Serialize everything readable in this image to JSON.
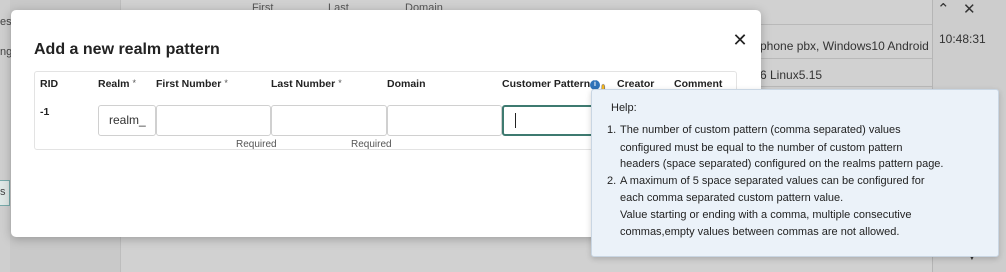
{
  "background": {
    "left_fragments": [
      "es",
      "ng",
      "s"
    ],
    "column_headers": [
      "First",
      "Last",
      "Domain"
    ],
    "row1_text": "phone pbx, Windows10 Android",
    "row2_text": "6 Linux5.15",
    "time": "10:48:31"
  },
  "modal": {
    "title": "Add a new realm pattern",
    "headers": {
      "rid": "RID",
      "realm": "Realm",
      "first_number": "First Number",
      "last_number": "Last Number",
      "domain": "Domain",
      "customer_pattern": "Customer Pattern",
      "creator": "Creator",
      "comment": "Comment"
    },
    "required_marker": "*",
    "row": {
      "rid": "-1",
      "realm_value": "realm_",
      "first_number_value": "",
      "last_number_value": "",
      "domain_value": "",
      "customer_pattern_value": ""
    },
    "required_note": "Required"
  },
  "tooltip": {
    "title": "Help:",
    "item1_num": "1.",
    "item1_lines": [
      "The number of custom pattern (comma separated) values",
      "configured must be equal to the number of custom pattern",
      "headers (space separated) configured on the realms pattern page."
    ],
    "item2_num": "2.",
    "item2_lines": [
      "A maximum of 5 space separated values can be configured for",
      "each comma separated custom pattern value.",
      "Value starting or ending with a comma, multiple consecutive",
      "commas,empty values between commas are not allowed."
    ]
  },
  "colors": {
    "accent": "#3e7a70",
    "info": "#2f72b8",
    "tooltip_bg": "#ebf2f9"
  }
}
